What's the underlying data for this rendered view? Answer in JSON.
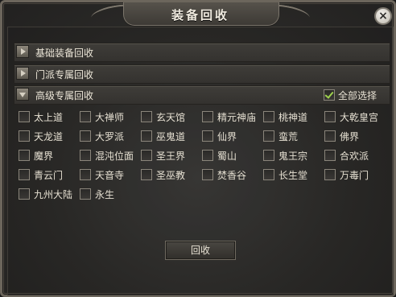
{
  "window": {
    "title": "装备回收",
    "close_label": "×"
  },
  "sections": [
    {
      "label": "基础装备回收",
      "expanded": false
    },
    {
      "label": "门派专属回收",
      "expanded": false
    },
    {
      "label": "高级专属回收",
      "expanded": true
    }
  ],
  "select_all": {
    "label": "全部选择",
    "checked": true
  },
  "options": [
    "太上道",
    "大禅师",
    "玄天馆",
    "精元神庙",
    "桃神道",
    "大乾皇宫",
    "天龙道",
    "大罗派",
    "巫鬼道",
    "仙界",
    "蛮荒",
    "佛界",
    "魔界",
    "混沌位面",
    "圣王界",
    "蜀山",
    "鬼王宗",
    "合欢派",
    "青云门",
    "天音寺",
    "圣巫教",
    "焚香谷",
    "长生堂",
    "万毒门",
    "九州大陆",
    "永生"
  ],
  "recycle_button": {
    "label": "回收"
  },
  "colors": {
    "check": "#9fd24e",
    "text": "#e6e0d2"
  }
}
